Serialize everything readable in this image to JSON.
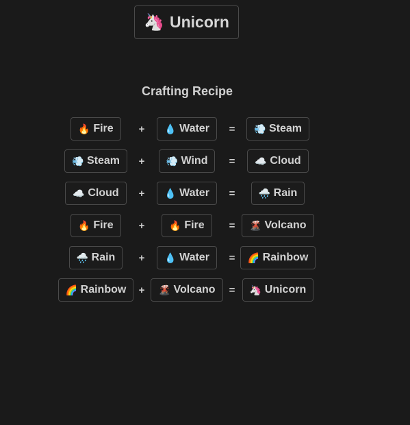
{
  "result_item": {
    "icon": "🦄",
    "icon_name": "unicorn-icon",
    "label": "Unicorn"
  },
  "recipe_title": "Crafting Recipe",
  "operators": {
    "plus": "+",
    "equals": "="
  },
  "recipes": [
    {
      "a": {
        "icon": "🔥",
        "label": "Fire"
      },
      "b": {
        "icon": "💧",
        "label": "Water"
      },
      "result": {
        "icon": "💨",
        "label": "Steam"
      }
    },
    {
      "a": {
        "icon": "💨",
        "label": "Steam"
      },
      "b": {
        "icon": "💨",
        "label": "Wind"
      },
      "result": {
        "icon": "☁️",
        "label": "Cloud"
      }
    },
    {
      "a": {
        "icon": "☁️",
        "label": "Cloud"
      },
      "b": {
        "icon": "💧",
        "label": "Water"
      },
      "result": {
        "icon": "🌧️",
        "label": "Rain"
      }
    },
    {
      "a": {
        "icon": "🔥",
        "label": "Fire"
      },
      "b": {
        "icon": "🔥",
        "label": "Fire"
      },
      "result": {
        "icon": "🌋",
        "label": "Volcano"
      }
    },
    {
      "a": {
        "icon": "🌧️",
        "label": "Rain"
      },
      "b": {
        "icon": "💧",
        "label": "Water"
      },
      "result": {
        "icon": "🌈",
        "label": "Rainbow"
      }
    },
    {
      "a": {
        "icon": "🌈",
        "label": "Rainbow"
      },
      "b": {
        "icon": "🌋",
        "label": "Volcano"
      },
      "result": {
        "icon": "🦄",
        "label": "Unicorn"
      }
    }
  ],
  "colors": {
    "background": "#1a1a1a",
    "text": "#d2d2d2",
    "border": "#4a4a4a"
  }
}
